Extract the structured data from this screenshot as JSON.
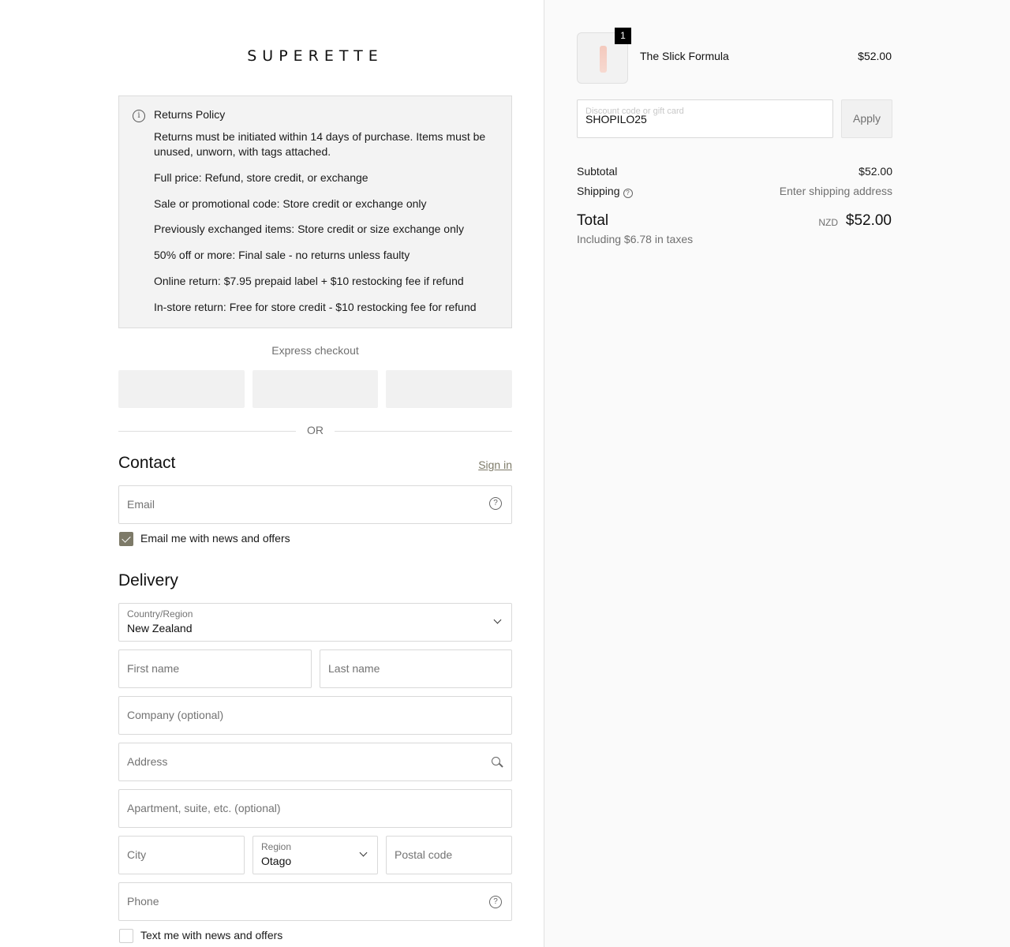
{
  "brand": {
    "logo_text": "SUPERETTE"
  },
  "returns_policy": {
    "title": "Returns Policy",
    "lines": [
      "Returns must be initiated within 14 days of purchase. Items must be unused, unworn, with tags attached.",
      "Full price: Refund, store credit, or exchange",
      "Sale or promotional code: Store credit or exchange only",
      "Previously exchanged items: Store credit or size exchange only",
      "50% off or more: Final sale - no returns unless faulty",
      "Online return: $7.95 prepaid label + $10 restocking fee if refund",
      "In-store return: Free for store credit - $10 restocking fee for refund"
    ]
  },
  "express": {
    "label": "Express checkout",
    "or_text": "OR"
  },
  "contact": {
    "heading": "Contact",
    "sign_in": "Sign in",
    "email_placeholder": "Email",
    "email_news_label": "Email me with news and offers",
    "email_news_checked": true
  },
  "delivery": {
    "heading": "Delivery",
    "country_label": "Country/Region",
    "country_value": "New Zealand",
    "first_name": "First name",
    "last_name": "Last name",
    "company": "Company (optional)",
    "address": "Address",
    "apartment": "Apartment, suite, etc. (optional)",
    "city": "City",
    "region_label": "Region",
    "region_value": "Otago",
    "postal": "Postal code",
    "phone": "Phone",
    "text_news_label": "Text me with news and offers",
    "text_news_checked": false
  },
  "summary": {
    "item": {
      "name": "The Slick Formula",
      "price": "$52.00",
      "quantity": "1"
    },
    "discount_placeholder": "Discount code or gift card",
    "discount_value": "SHOPILO25",
    "apply_label": "Apply",
    "subtotal_label": "Subtotal",
    "subtotal_value": "$52.00",
    "shipping_label": "Shipping",
    "shipping_value": "Enter shipping address",
    "total_label": "Total",
    "total_currency": "NZD",
    "total_value": "$52.00",
    "taxes_note": "Including $6.78 in taxes"
  },
  "colors": {
    "accent": "#7d7a68",
    "summary_bg": "#fafafa",
    "policy_bg": "#f3f3f3"
  }
}
